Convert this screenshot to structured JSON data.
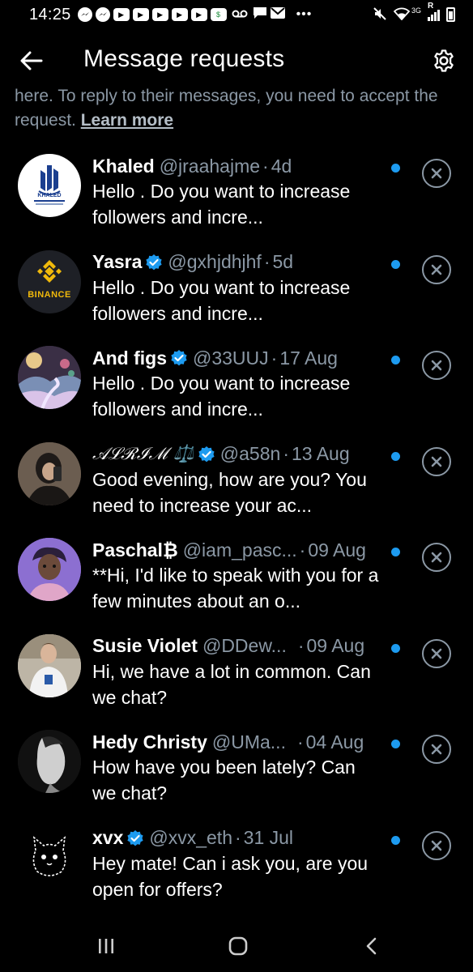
{
  "status_bar": {
    "time": "14:25",
    "network": "3G",
    "roaming": "R"
  },
  "header": {
    "title": "Message requests"
  },
  "intro": {
    "text": "here. To reply to their messages, you need to accept the request.",
    "link": "Learn more"
  },
  "requests": [
    {
      "name": "Khaled",
      "verified": false,
      "handle": "@jraahajme",
      "time": "4d",
      "preview": "Hello . Do you want to increase followers and incre...",
      "avatar_label": "KHALED",
      "avatar_icon": "khaled-logo-icon"
    },
    {
      "name": "Yasra",
      "verified": true,
      "handle": "@gxhjdhjhf",
      "time": "5d",
      "preview": "Hello . Do you want to increase followers and incre...",
      "avatar_label": "BINANCE",
      "avatar_icon": "binance-logo-icon"
    },
    {
      "name": "And figs",
      "verified": true,
      "handle": "@33UUJ",
      "time": "17 Aug",
      "preview": "Hello . Do you want to increase followers and incre...",
      "avatar_icon": "landscape-art-avatar"
    },
    {
      "name": "𝒜ℒℛℐℳ ⚖️",
      "verified": true,
      "handle": "@a58n",
      "time": "13 Aug",
      "preview": "Good evening, how are you? You need to increase your ac...",
      "avatar_icon": "person-photo-avatar"
    },
    {
      "name": "Paschal₿",
      "verified": false,
      "handle": "@iam_pasc...",
      "time": "09 Aug",
      "preview": "**Hi, I'd like to speak with you for a few minutes about an o...",
      "avatar_icon": "cartoon-avatar"
    },
    {
      "name": "Susie Violet",
      "verified": false,
      "handle": "@DDew...",
      "time": "09 Aug",
      "preview": "Hi, we have a lot in common. Can we chat?",
      "avatar_icon": "person-photo-avatar"
    },
    {
      "name": "Hedy Christy",
      "verified": false,
      "handle": "@UMa...",
      "time": "04 Aug",
      "preview": "How have you been lately? Can we chat?",
      "avatar_icon": "person-photo-avatar"
    },
    {
      "name": "xvx",
      "verified": true,
      "handle": "@xvx_eth",
      "time": "31 Jul",
      "preview": "Hey mate! Can i ask you, are you open for offers?",
      "avatar_icon": "cat-sketch-avatar"
    }
  ],
  "colors": {
    "background": "#000000",
    "accent": "#1d9bf0",
    "secondary_text": "#8b98a5",
    "binance_yellow": "#f0b90b"
  }
}
